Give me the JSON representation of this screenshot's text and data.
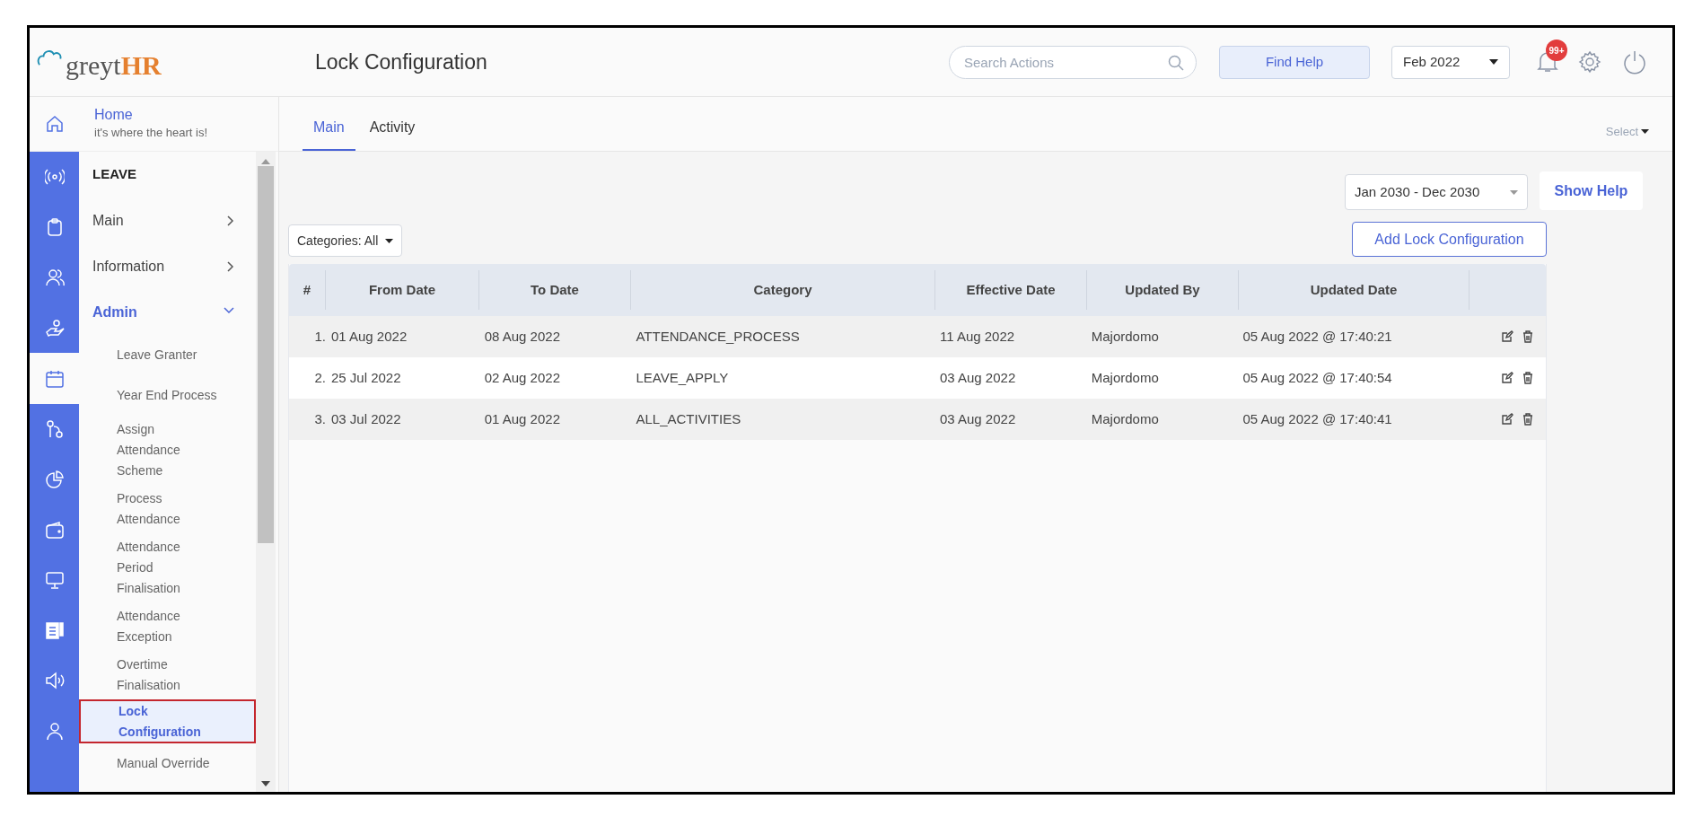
{
  "header": {
    "title": "Lock Configuration",
    "search": {
      "placeholder": "Search Actions"
    },
    "find_help": "Find Help",
    "month": "Feb 2022",
    "notification_badge": "99+"
  },
  "logo": {
    "grey": "greyt",
    "hr": "HR"
  },
  "home": {
    "title": "Home",
    "subtitle": "it's where the heart is!"
  },
  "rail_icons": [
    {
      "kind": "home",
      "selected": false
    },
    {
      "kind": "radio",
      "selected": false
    },
    {
      "kind": "clipboard",
      "selected": false
    },
    {
      "kind": "users",
      "selected": false
    },
    {
      "kind": "hand",
      "selected": false
    },
    {
      "kind": "calendar",
      "selected": true
    },
    {
      "kind": "branch",
      "selected": false
    },
    {
      "kind": "pie",
      "selected": false
    },
    {
      "kind": "wallet",
      "selected": false
    },
    {
      "kind": "monitor",
      "selected": false
    },
    {
      "kind": "document",
      "selected": false
    },
    {
      "kind": "speaker",
      "selected": false
    },
    {
      "kind": "user",
      "selected": false
    }
  ],
  "nav": [
    {
      "kind": "section",
      "label": "LEAVE"
    },
    {
      "kind": "group",
      "label": "Main",
      "expanded": false
    },
    {
      "kind": "group",
      "label": "Information",
      "expanded": false
    },
    {
      "kind": "group",
      "label": "Admin",
      "expanded": true
    },
    {
      "kind": "item",
      "label": "Leave Granter",
      "selected": false
    },
    {
      "kind": "item",
      "label": "Year End Process",
      "selected": false
    },
    {
      "kind": "item",
      "label": "Assign Attendance Scheme",
      "selected": false
    },
    {
      "kind": "item",
      "label": "Process Attendance",
      "selected": false
    },
    {
      "kind": "item",
      "label": "Attendance Period Finalisation",
      "selected": false
    },
    {
      "kind": "item",
      "label": "Attendance Exception",
      "selected": false
    },
    {
      "kind": "item",
      "label": "Overtime Finalisation",
      "selected": false
    },
    {
      "kind": "item",
      "label": "Lock Configuration",
      "selected": true
    },
    {
      "kind": "item",
      "label": "Manual Override",
      "selected": false
    }
  ],
  "tabs": [
    {
      "label": "Main",
      "selected": true
    },
    {
      "label": "Activity",
      "selected": false
    }
  ],
  "select_menu": "Select",
  "date_range": "Jan 2030 - Dec 2030",
  "show_help": "Show Help",
  "categories_filter": "Categories: All",
  "add_button": "Add Lock Configuration",
  "table": {
    "columns": [
      "#",
      "From Date",
      "To Date",
      "Category",
      "Effective Date",
      "Updated By",
      "Updated Date"
    ],
    "rows": [
      {
        "cells": [
          "1.",
          "01 Aug 2022",
          "08 Aug 2022",
          "ATTENDANCE_PROCESS",
          "11 Aug 2022",
          "Majordomo",
          "05 Aug 2022 @ 17:40:21"
        ]
      },
      {
        "cells": [
          "2.",
          "25 Jul 2022",
          "02 Aug 2022",
          "LEAVE_APPLY",
          "03 Aug 2022",
          "Majordomo",
          "05 Aug 2022 @ 17:40:54"
        ]
      },
      {
        "cells": [
          "3.",
          "03 Jul 2022",
          "01 Aug 2022",
          "ALL_ACTIVITIES",
          "03 Aug 2022",
          "Majordomo",
          "05 Aug 2022 @ 17:40:41"
        ]
      }
    ]
  }
}
